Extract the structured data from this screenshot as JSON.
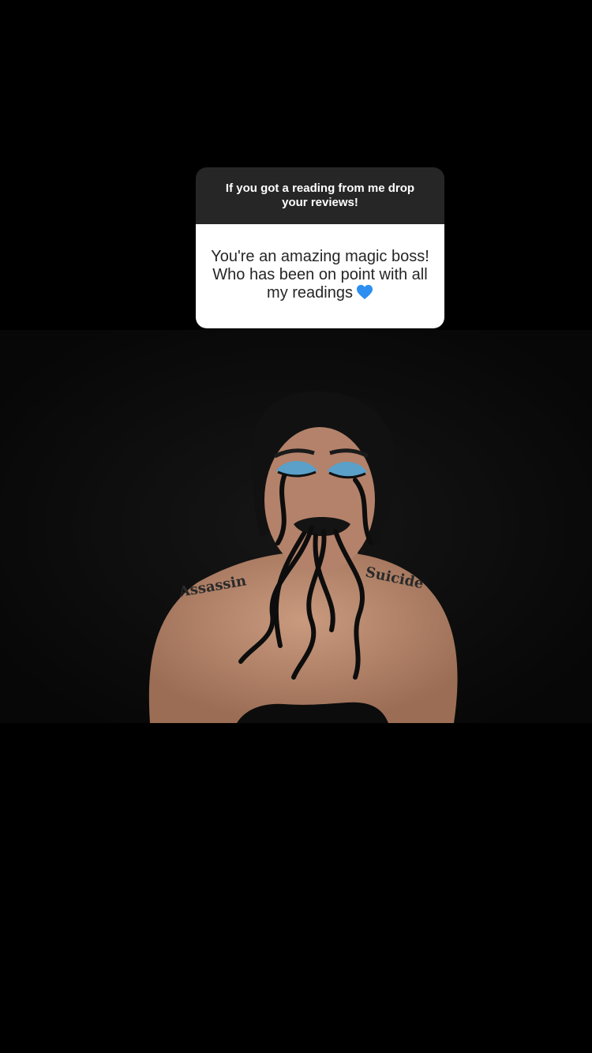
{
  "sticker": {
    "question": "If you got a reading from me drop your reviews!",
    "answer": "You're an amazing magic boss! Who has been on point with all my readings",
    "answer_emoji_icon": "blue-heart-icon"
  },
  "photo": {
    "tattoo_left": "Assassin",
    "tattoo_right": "Suicide"
  },
  "colors": {
    "header_bg": "#262626",
    "answer_bg": "#ffffff",
    "heart": "#2d8ff0",
    "eyeshadow": "#5aa0c8"
  }
}
